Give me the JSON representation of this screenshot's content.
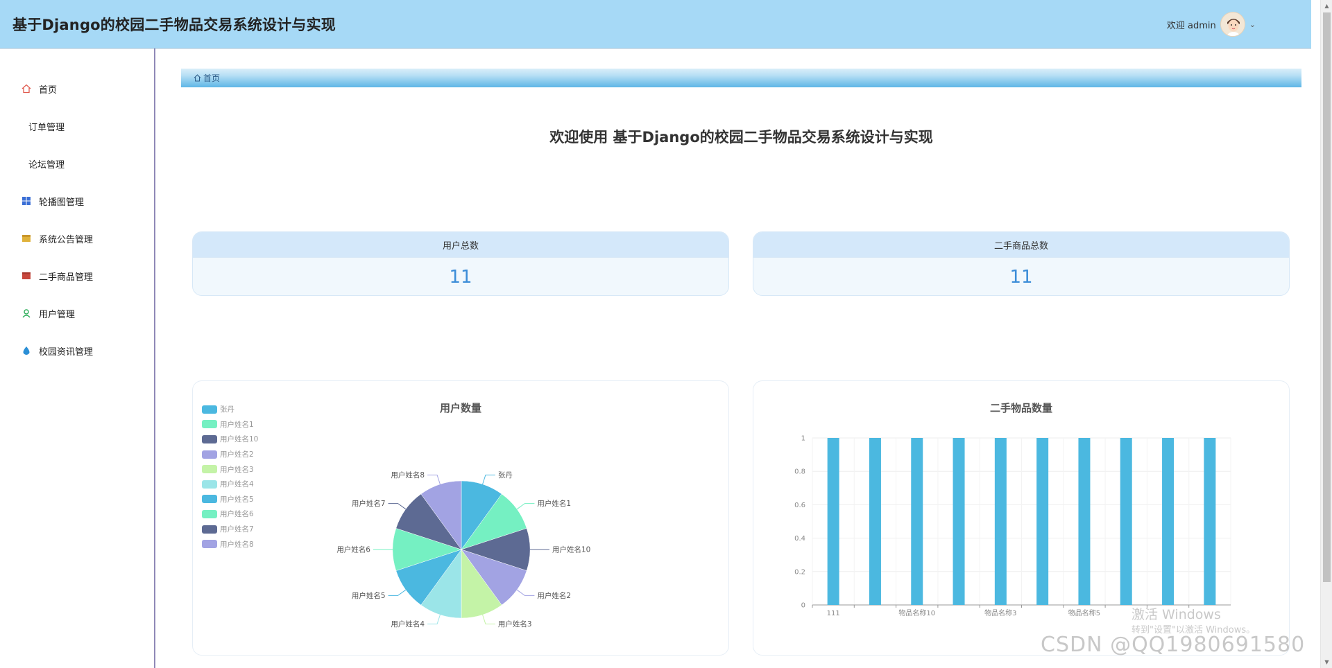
{
  "header": {
    "title": "基于Django的校园二手物品交易系统设计与实现",
    "welcome_user": "欢迎 admin"
  },
  "sidebar": {
    "items": [
      {
        "label": "首页",
        "icon": "home-icon",
        "color": "#e05b4f"
      },
      {
        "label": "订单管理",
        "icon": "",
        "color": ""
      },
      {
        "label": "论坛管理",
        "icon": "",
        "color": ""
      },
      {
        "label": "轮播图管理",
        "icon": "grid-icon",
        "color": "#3b6fd6"
      },
      {
        "label": "系统公告管理",
        "icon": "notice-icon",
        "color": "#e0b23a"
      },
      {
        "label": "二手商品管理",
        "icon": "box-icon",
        "color": "#c8473d"
      },
      {
        "label": "用户管理",
        "icon": "user-icon",
        "color": "#2fae5b"
      },
      {
        "label": "校园资讯管理",
        "icon": "drop-icon",
        "color": "#2b8fd6"
      }
    ]
  },
  "breadcrumb": {
    "label": "首页"
  },
  "main": {
    "welcome": "欢迎使用 基于Django的校园二手物品交易系统设计与实现",
    "stats": [
      {
        "label": "用户总数",
        "value": "11"
      },
      {
        "label": "二手商品总数",
        "value": "11"
      }
    ]
  },
  "chart_data": [
    {
      "type": "pie",
      "title": "用户数量",
      "labels": [
        "张丹",
        "用户姓名1",
        "用户姓名10",
        "用户姓名2",
        "用户姓名3",
        "用户姓名4",
        "用户姓名5",
        "用户姓名6",
        "用户姓名7",
        "用户姓名8"
      ],
      "values": [
        1,
        1,
        1,
        1,
        1,
        1,
        1,
        1,
        1,
        1
      ],
      "colors": [
        "#4bb8e0",
        "#75f0c2",
        "#5d6a93",
        "#a2a3e3",
        "#c4f3a7",
        "#9be5e8",
        "#4bb8e0",
        "#75f0c2",
        "#5d6a93",
        "#a2a3e3"
      ],
      "legend_position": "top-left"
    },
    {
      "type": "bar",
      "title": "二手物品数量",
      "categories": [
        "111",
        "",
        "物品名称10",
        "",
        "物品名称3",
        "",
        "物品名称5",
        "",
        "",
        ""
      ],
      "values": [
        1,
        1,
        1,
        1,
        1,
        1,
        1,
        1,
        1,
        1
      ],
      "ylim": [
        0,
        1
      ],
      "yticks": [
        "0",
        "0.2",
        "0.4",
        "0.6",
        "0.8",
        "1"
      ],
      "grid": true,
      "color": "#4bb8e0"
    }
  ],
  "watermarks": {
    "windows_line1": "激活 Windows",
    "windows_line2": "转到\"设置\"以激活 Windows。",
    "csdn": "CSDN @QQ1980691580"
  }
}
